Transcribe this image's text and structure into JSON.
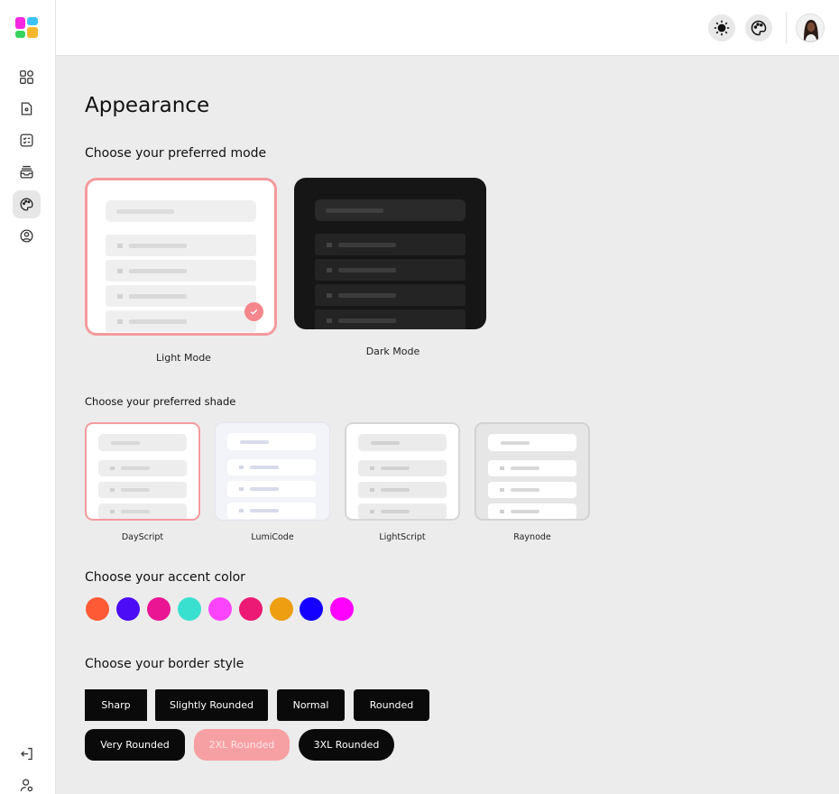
{
  "page": {
    "title": "Appearance"
  },
  "sections": {
    "mode": "Choose your preferred mode",
    "shade": "Choose your preferred shade",
    "accent": "Choose your accent color",
    "border": "Choose your border style"
  },
  "modes": [
    {
      "label": "Light Mode",
      "selected": true
    },
    {
      "label": "Dark Mode",
      "selected": false
    }
  ],
  "shades": [
    {
      "label": "DayScript",
      "selected": true
    },
    {
      "label": "LumiCode",
      "selected": false
    },
    {
      "label": "LightScript",
      "selected": false
    },
    {
      "label": "Raynode",
      "selected": false
    }
  ],
  "accent_colors": [
    "#fe5a35",
    "#4c0cf5",
    "#e91593",
    "#3ae0cf",
    "#fd44fd",
    "#ec1a74",
    "#ed9e11",
    "#1400ff",
    "#ff00ff"
  ],
  "border_styles": [
    {
      "label": "Sharp",
      "selected": false
    },
    {
      "label": "Slightly Rounded",
      "selected": false
    },
    {
      "label": "Normal",
      "selected": false
    },
    {
      "label": "Rounded",
      "selected": false
    },
    {
      "label": "Very Rounded",
      "selected": false
    },
    {
      "label": "2XL Rounded",
      "selected": true
    },
    {
      "label": "3XL Rounded",
      "selected": false
    }
  ],
  "sidebar": {
    "items": [
      {
        "icon": "dashboard-icon"
      },
      {
        "icon": "folder-icon"
      },
      {
        "icon": "checklist-icon"
      },
      {
        "icon": "inbox-icon"
      },
      {
        "icon": "palette-icon",
        "active": true
      },
      {
        "icon": "user-circle-icon"
      }
    ],
    "bottom": [
      {
        "icon": "logout-icon"
      },
      {
        "icon": "user-settings-icon"
      }
    ]
  },
  "header": {
    "buttons": [
      {
        "icon": "sun-icon"
      },
      {
        "icon": "palette-icon"
      }
    ],
    "avatar": "avatar"
  },
  "colors": {
    "accent": "#f59a9d",
    "selected_button": "#f7a0a3"
  }
}
